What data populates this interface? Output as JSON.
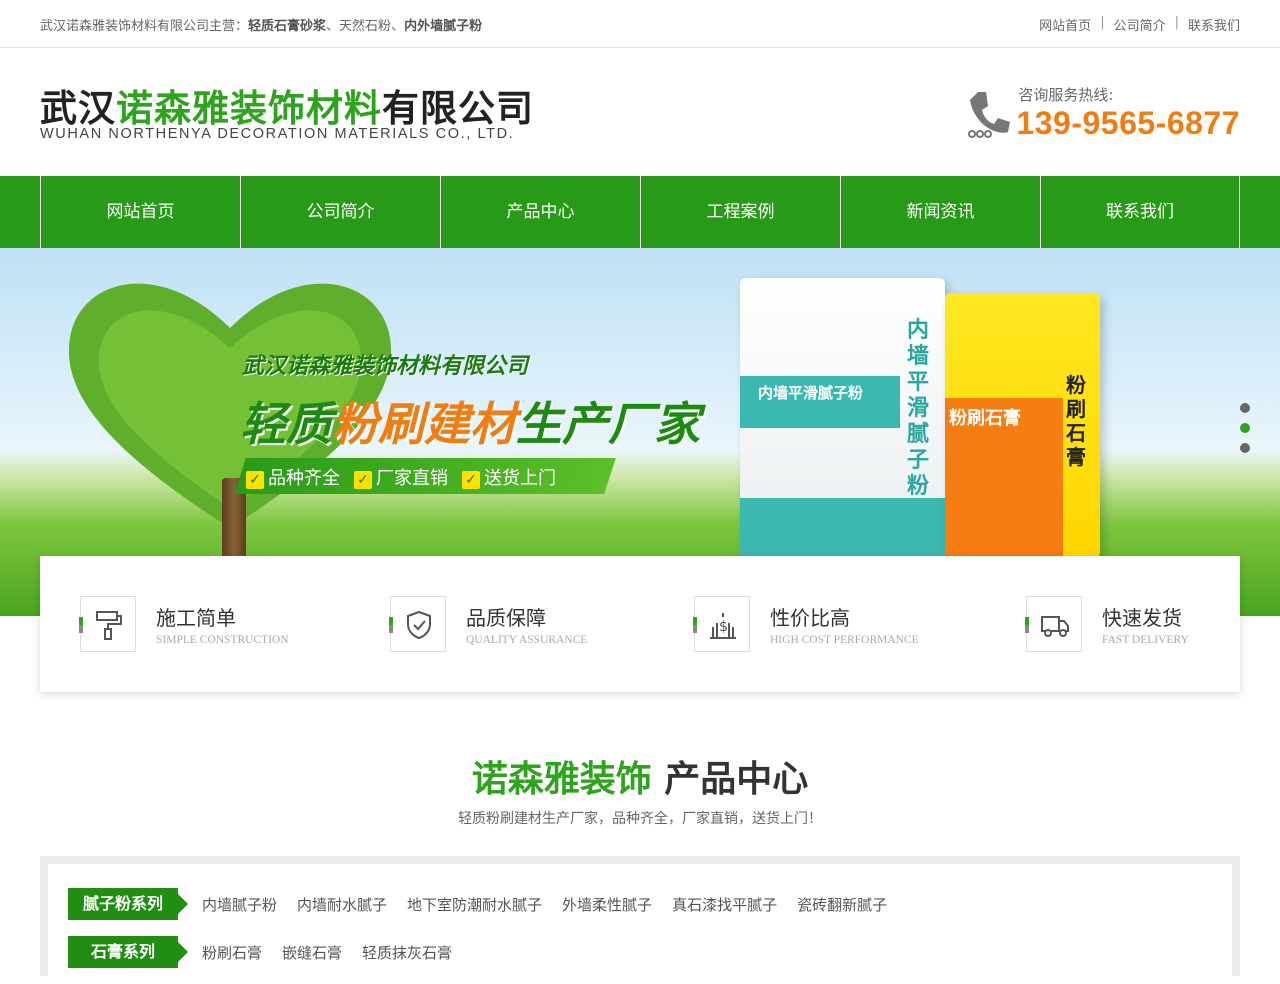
{
  "topbar": {
    "intro_prefix": "武汉诺森雅装饰材料有限公司主营：",
    "intro_item1": "轻质石膏砂浆",
    "intro_sep1": "、",
    "intro_item2": "天然石粉",
    "intro_sep2": "、",
    "intro_item3": "内外墙腻子粉",
    "links": [
      "网站首页",
      "公司简介",
      "联系我们"
    ]
  },
  "header": {
    "logo_cn_part1": "武汉",
    "logo_cn_part2": "诺森雅装饰材料",
    "logo_cn_part3": "有限公司",
    "logo_en": "WUHAN NORTHENYA DECORATION MATERIALS CO., LTD.",
    "hotline_label": "咨询服务热线:",
    "hotline_number": "139-9565-6877"
  },
  "nav": {
    "items": [
      "网站首页",
      "公司简介",
      "产品中心",
      "工程案例",
      "新闻资讯",
      "联系我们"
    ]
  },
  "banner": {
    "company": "武汉诺森雅装饰材料有限公司",
    "slogan_part1": "轻质",
    "slogan_part2": "粉刷建材",
    "slogan_part3": "生产厂家",
    "features": [
      "品种齐全",
      "厂家直销",
      "送货上门"
    ],
    "bag1_label": "内墙平滑腻子粉",
    "bag1_vertical": "内墙平滑腻子粉",
    "bag2_label": "粉刷石膏",
    "bag2_vertical": "粉刷石膏",
    "active_slide": 2
  },
  "features": [
    {
      "title": "施工简单",
      "subtitle": "SIMPLE CONSTRUCTION",
      "icon": "paint-roller-icon"
    },
    {
      "title": "品质保障",
      "subtitle": "QUALITY ASSURANCE",
      "icon": "shield-check-icon"
    },
    {
      "title": "性价比高",
      "subtitle": "HIGH COST PERFORMANCE",
      "icon": "dollar-chart-icon"
    },
    {
      "title": "快速发货",
      "subtitle": "FAST DELIVERY",
      "icon": "truck-icon"
    }
  ],
  "products": {
    "title_green": "诺森雅装饰",
    "title_dark": "产品中心",
    "subtitle": "轻质粉刷建材生产厂家，品种齐全，厂家直销，送货上门！",
    "categories": [
      {
        "name": "腻子粉系列",
        "items": [
          "内墙腻子粉",
          "内墙耐水腻子",
          "地下室防潮耐水腻子",
          "外墙柔性腻子",
          "真石漆找平腻子",
          "瓷砖翻新腻子"
        ]
      },
      {
        "name": "石膏系列",
        "items": [
          "粉刷石膏",
          "嵌缝石膏",
          "轻质抹灰石膏"
        ]
      }
    ]
  },
  "colors": {
    "brand_green": "#279a17",
    "accent_orange": "#f07c12"
  }
}
